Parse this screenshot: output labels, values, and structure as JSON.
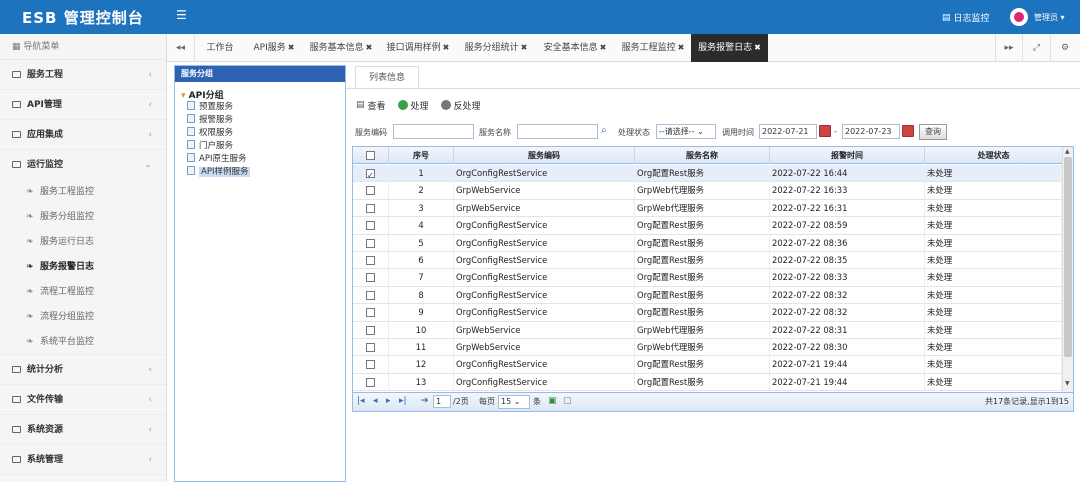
{
  "header": {
    "brand": "ESB 管理控制台",
    "log_monitor": "日志监控",
    "admin": "管理员"
  },
  "sidebar": {
    "title": "导航菜单",
    "menus": [
      {
        "label": "服务工程"
      },
      {
        "label": "API管理"
      },
      {
        "label": "应用集成"
      },
      {
        "label": "运行监控"
      },
      {
        "label": "统计分析"
      },
      {
        "label": "文件传输"
      },
      {
        "label": "系统资源"
      },
      {
        "label": "系统管理"
      }
    ],
    "sub_items": [
      {
        "label": "服务工程监控"
      },
      {
        "label": "服务分组监控"
      },
      {
        "label": "服务运行日志"
      },
      {
        "label": "服务报警日志"
      },
      {
        "label": "流程工程监控"
      },
      {
        "label": "流程分组监控"
      },
      {
        "label": "系统平台监控"
      }
    ]
  },
  "tabs": [
    {
      "label": "工作台"
    },
    {
      "label": "API服务"
    },
    {
      "label": "服务基本信息"
    },
    {
      "label": "接口调用样例"
    },
    {
      "label": "服务分组统计"
    },
    {
      "label": "安全基本信息"
    },
    {
      "label": "服务工程监控"
    },
    {
      "label": "服务报警日志"
    }
  ],
  "tree": {
    "title": "服务分组",
    "root": "API分组",
    "nodes": [
      "预置服务",
      "报警服务",
      "权限服务",
      "门户服务",
      "API原生服务",
      "API样例服务"
    ]
  },
  "content": {
    "tab": "列表信息",
    "toolbar": {
      "view": "查看",
      "process": "处理",
      "unprocess": "反处理"
    },
    "filter": {
      "service_code_label": "服务编码",
      "service_name_label": "服务名称",
      "status_label": "处理状态",
      "status_value": "--请选择--",
      "time_label": "调用时间",
      "date_from": "2022-07-21",
      "dash": "-",
      "date_to": "2022-07-23",
      "query": "查询"
    },
    "columns": [
      "序号",
      "服务编码",
      "服务名称",
      "报警时间",
      "处理状态"
    ],
    "rows": [
      {
        "no": "1",
        "code": "OrgConfigRestService",
        "name": "Org配置Rest服务",
        "time": "2022-07-22 16:44",
        "status": "未处理",
        "checked": true
      },
      {
        "no": "2",
        "code": "GrpWebService",
        "name": "GrpWeb代理服务",
        "time": "2022-07-22 16:33",
        "status": "未处理",
        "checked": false
      },
      {
        "no": "3",
        "code": "GrpWebService",
        "name": "GrpWeb代理服务",
        "time": "2022-07-22 16:31",
        "status": "未处理",
        "checked": false
      },
      {
        "no": "4",
        "code": "OrgConfigRestService",
        "name": "Org配置Rest服务",
        "time": "2022-07-22 08:59",
        "status": "未处理",
        "checked": false
      },
      {
        "no": "5",
        "code": "OrgConfigRestService",
        "name": "Org配置Rest服务",
        "time": "2022-07-22 08:36",
        "status": "未处理",
        "checked": false
      },
      {
        "no": "6",
        "code": "OrgConfigRestService",
        "name": "Org配置Rest服务",
        "time": "2022-07-22 08:35",
        "status": "未处理",
        "checked": false
      },
      {
        "no": "7",
        "code": "OrgConfigRestService",
        "name": "Org配置Rest服务",
        "time": "2022-07-22 08:33",
        "status": "未处理",
        "checked": false
      },
      {
        "no": "8",
        "code": "OrgConfigRestService",
        "name": "Org配置Rest服务",
        "time": "2022-07-22 08:32",
        "status": "未处理",
        "checked": false
      },
      {
        "no": "9",
        "code": "OrgConfigRestService",
        "name": "Org配置Rest服务",
        "time": "2022-07-22 08:32",
        "status": "未处理",
        "checked": false
      },
      {
        "no": "10",
        "code": "GrpWebService",
        "name": "GrpWeb代理服务",
        "time": "2022-07-22 08:31",
        "status": "未处理",
        "checked": false
      },
      {
        "no": "11",
        "code": "GrpWebService",
        "name": "GrpWeb代理服务",
        "time": "2022-07-22 08:30",
        "status": "未处理",
        "checked": false
      },
      {
        "no": "12",
        "code": "OrgConfigRestService",
        "name": "Org配置Rest服务",
        "time": "2022-07-21 19:44",
        "status": "未处理",
        "checked": false
      },
      {
        "no": "13",
        "code": "OrgConfigRestService",
        "name": "Org配置Rest服务",
        "time": "2022-07-21 19:44",
        "status": "未处理",
        "checked": false
      }
    ],
    "pager": {
      "page": "1",
      "total_pages": "/2页",
      "per_page_label": "每页",
      "per_page": "15",
      "unit": "条",
      "summary": "共17条记录,显示1到15"
    }
  },
  "colors": {
    "header": "#1e73be",
    "active_tab": "#2b2b2b",
    "tree_title": "#2e63b4"
  }
}
